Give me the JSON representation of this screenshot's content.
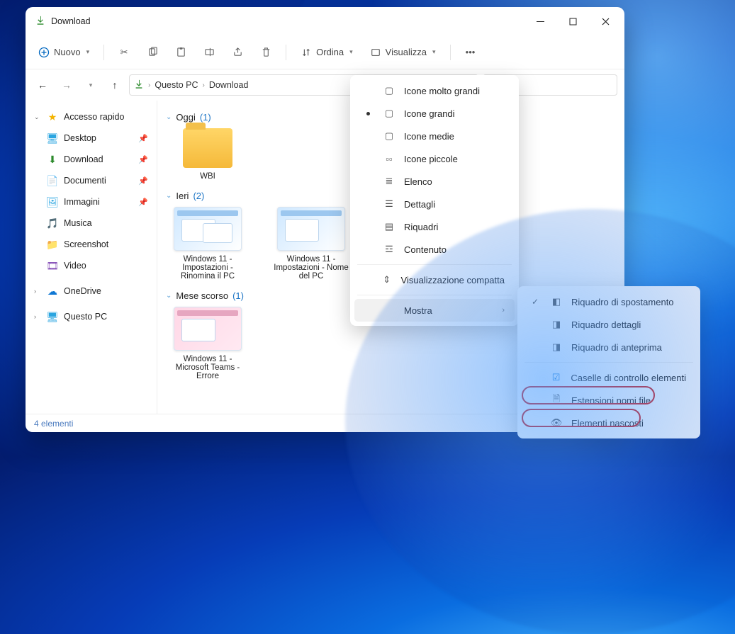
{
  "window": {
    "title": "Download"
  },
  "cmdbar": {
    "new": "Nuovo",
    "sort": "Ordina",
    "view": "Visualizza"
  },
  "address": {
    "root": "Questo PC",
    "folder": "Download"
  },
  "sidebar": {
    "quick": "Accesso rapido",
    "items": [
      {
        "label": "Desktop"
      },
      {
        "label": "Download"
      },
      {
        "label": "Documenti"
      },
      {
        "label": "Immagini"
      },
      {
        "label": "Musica"
      },
      {
        "label": "Screenshot"
      },
      {
        "label": "Video"
      }
    ],
    "onedrive": "OneDrive",
    "thispc": "Questo PC"
  },
  "groups": {
    "today": {
      "label": "Oggi",
      "count": "(1)"
    },
    "yesterday": {
      "label": "Ieri",
      "count": "(2)"
    },
    "lastmonth": {
      "label": "Mese scorso",
      "count": "(1)"
    }
  },
  "files": {
    "wbi": "WBI",
    "f1": "Windows 11 - Impostazioni - Rinomina il PC",
    "f2": "Windows 11 - Impostazioni - Nome del PC",
    "f3": "Windows 11 - Microsoft Teams - Errore"
  },
  "status": "4 elementi",
  "menu1": {
    "xl": "Icone molto grandi",
    "lg": "Icone grandi",
    "md": "Icone medie",
    "sm": "Icone piccole",
    "list": "Elenco",
    "details": "Dettagli",
    "tiles": "Riquadri",
    "content": "Contenuto",
    "compact": "Visualizzazione compatta",
    "show": "Mostra"
  },
  "menu2": {
    "navpane": "Riquadro di spostamento",
    "detailspane": "Riquadro dettagli",
    "previewpane": "Riquadro di anteprima",
    "checkboxes": "Caselle di controllo elementi",
    "ext": "Estensioni nomi file",
    "hidden": "Elementi nascosti"
  }
}
